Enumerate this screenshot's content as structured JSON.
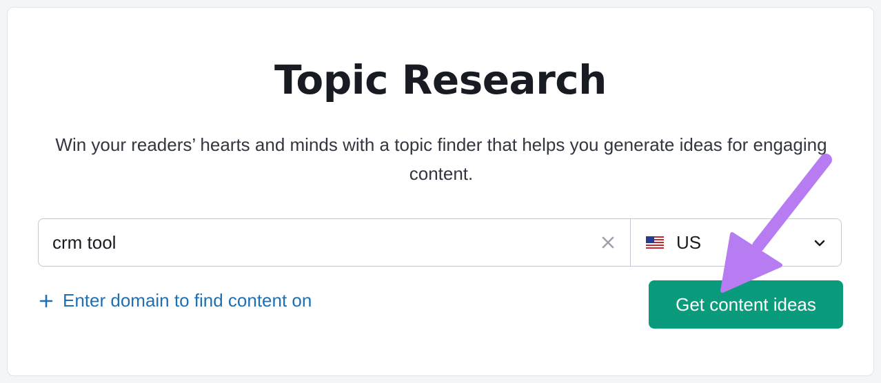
{
  "header": {
    "title": "Topic Research",
    "subtitle": "Win your readers’ hearts and minds with a topic finder that helps you generate ideas for engaging content."
  },
  "search": {
    "value": "crm tool",
    "clear_icon": "close-icon"
  },
  "country": {
    "selected": "US",
    "flag_icon": "us-flag-icon",
    "dropdown_icon": "chevron-down-icon"
  },
  "domain_link": {
    "label": "Enter domain to find content on",
    "icon": "plus-icon"
  },
  "cta": {
    "label": "Get content ideas"
  },
  "colors": {
    "primary_button": "#0a9b7c",
    "link": "#1e6fb3",
    "annotation_arrow": "#b77cf2"
  }
}
